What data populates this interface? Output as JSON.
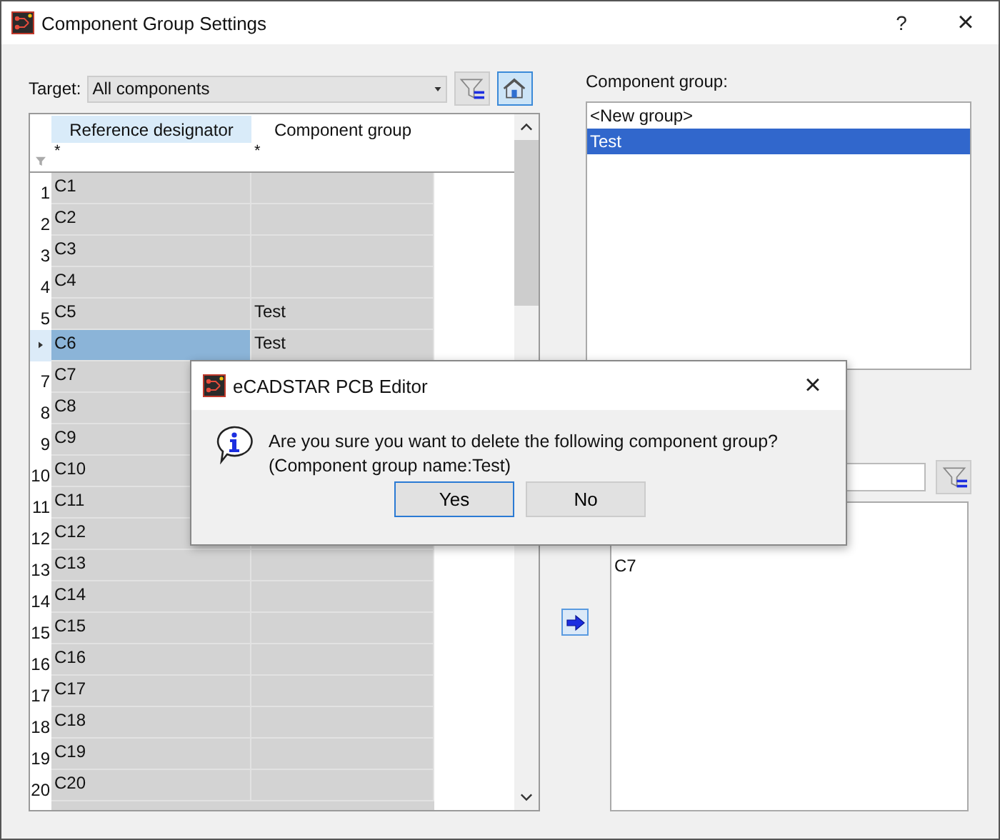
{
  "window": {
    "title": "Component Group Settings",
    "help": "?",
    "close": "×"
  },
  "target": {
    "label": "Target:",
    "value": "All components"
  },
  "toolbar": [
    {
      "kind": "filter",
      "selected": false
    },
    {
      "kind": "home",
      "selected": true
    }
  ],
  "grid": {
    "columns": [
      {
        "label": "Reference designator",
        "selected": true,
        "filter": "*"
      },
      {
        "label": "Component group",
        "selected": false,
        "filter": "*"
      }
    ],
    "rows": [
      {
        "number": "1",
        "designator": "C1",
        "current": false
      },
      {
        "number": "2",
        "designator": "C2",
        "current": false
      },
      {
        "number": "3",
        "designator": "C3",
        "current": false
      },
      {
        "number": "4",
        "designator": "C4",
        "current": false
      },
      {
        "number": "5",
        "designator": "C5",
        "group": "Test",
        "current": false
      },
      {
        "designator": "C6",
        "group": "Test",
        "current": true
      },
      {
        "number": "7",
        "designator": "C7",
        "current": false
      },
      {
        "number": "8",
        "designator": "C8",
        "current": false
      },
      {
        "number": "9",
        "designator": "C9",
        "current": false
      },
      {
        "number": "10",
        "designator": "C10",
        "current": false
      },
      {
        "number": "11",
        "designator": "C11",
        "current": false
      },
      {
        "number": "12",
        "designator": "C12",
        "current": false
      },
      {
        "number": "13",
        "designator": "C13",
        "current": false
      },
      {
        "number": "14",
        "designator": "C14",
        "current": false
      },
      {
        "number": "15",
        "designator": "C15",
        "current": false
      },
      {
        "number": "16",
        "designator": "C16",
        "current": false
      },
      {
        "number": "17",
        "designator": "C17",
        "current": false
      },
      {
        "number": "18",
        "designator": "C18",
        "current": false
      },
      {
        "number": "19",
        "designator": "C19",
        "current": false
      },
      {
        "number": "20",
        "designator": "C20",
        "current": false
      }
    ]
  },
  "group_panel": {
    "label": "Component group:",
    "items": [
      {
        "label": "<New group>",
        "selected": false
      },
      {
        "label": "Test",
        "selected": true
      }
    ]
  },
  "members": {
    "items": [
      "C7"
    ]
  },
  "dialog": {
    "title": "eCADSTAR PCB Editor",
    "close": "×",
    "message": "Are you sure you want to delete the following component group?",
    "detail": "(Component group name:Test)",
    "buttons": [
      {
        "label": "Yes",
        "focused": true
      },
      {
        "label": "No",
        "focused": false
      }
    ]
  }
}
